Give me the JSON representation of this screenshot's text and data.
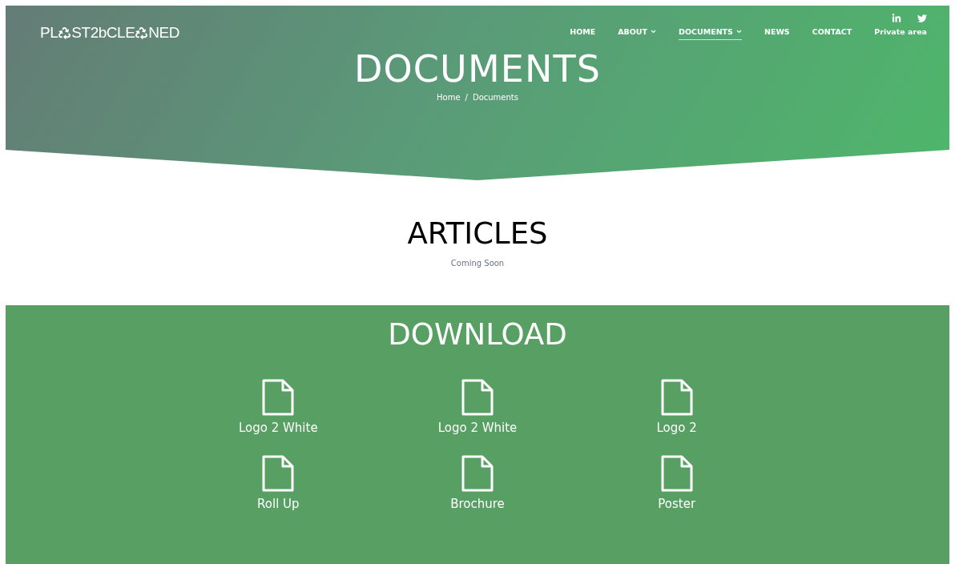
{
  "logo": {
    "parts": [
      "PL",
      "ST2bCLE",
      "NED"
    ]
  },
  "social": [
    {
      "kind": "linkedin"
    },
    {
      "kind": "twitter"
    }
  ],
  "nav": [
    {
      "label": "HOME",
      "dropdown": false,
      "selected": false
    },
    {
      "label": "ABOUT",
      "dropdown": true,
      "selected": false
    },
    {
      "label": "DOCUMENTS",
      "dropdown": true,
      "selected": true
    },
    {
      "label": "NEWS",
      "dropdown": false,
      "selected": false
    },
    {
      "label": "CONTACT",
      "dropdown": false,
      "selected": false
    },
    {
      "label": "Private area",
      "dropdown": false,
      "selected": false
    }
  ],
  "hero": {
    "title": "DOCUMENTS",
    "breadcrumb": [
      "Home",
      "Documents"
    ],
    "separator": "/"
  },
  "articles": {
    "title": "ARTICLES",
    "note": "Coming Soon"
  },
  "download": {
    "title": "DOWNLOAD",
    "files": [
      {
        "label": "Logo 2 White"
      },
      {
        "label": "Logo 2 White"
      },
      {
        "label": "Logo 2"
      },
      {
        "label": "Roll Up"
      },
      {
        "label": "Brochure"
      },
      {
        "label": "Poster"
      }
    ]
  }
}
